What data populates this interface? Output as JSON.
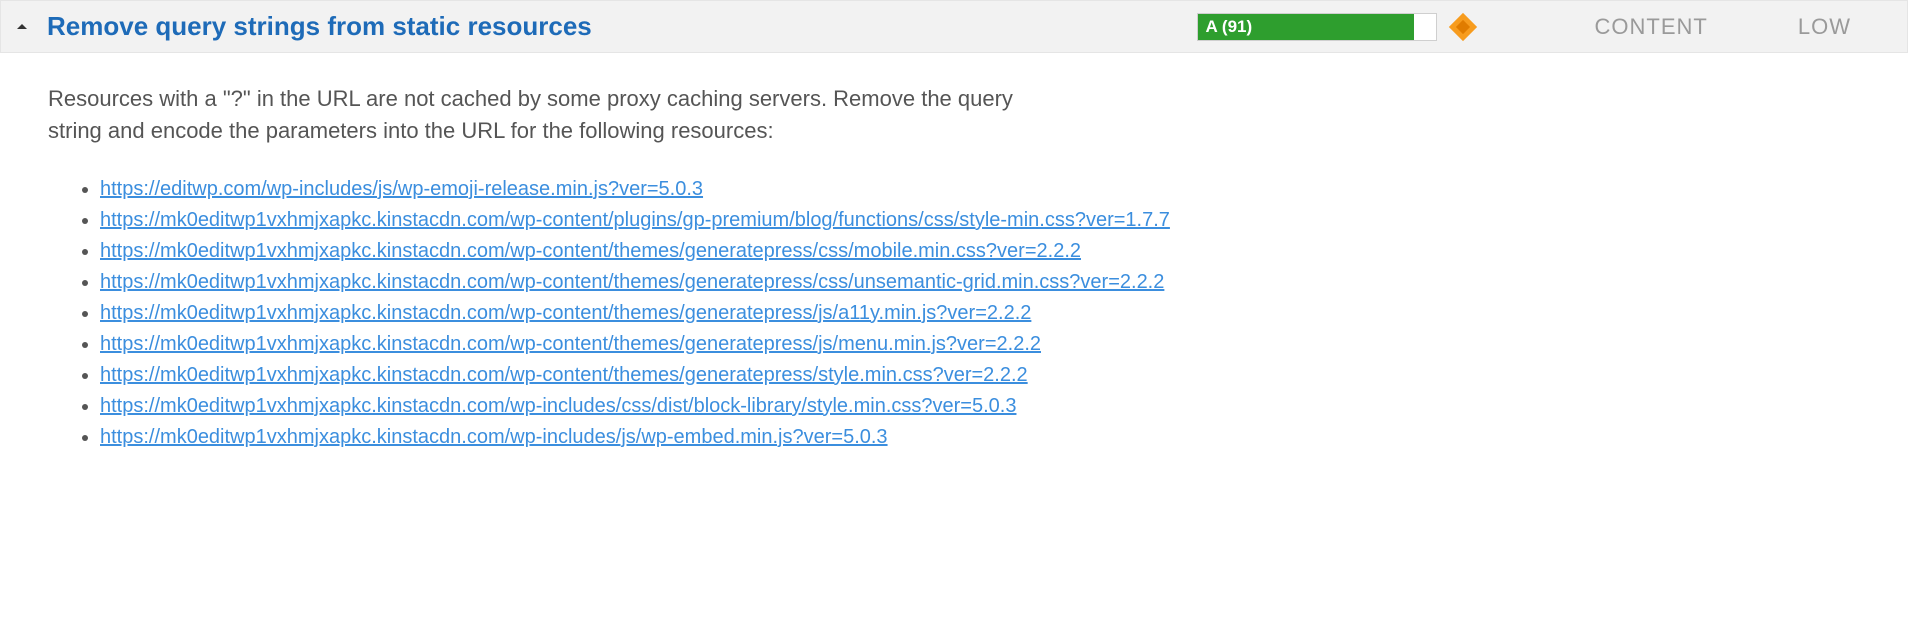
{
  "header": {
    "title": "Remove query strings from static resources",
    "grade_label": "A (91)",
    "grade_percent": 91,
    "category": "CONTENT",
    "priority": "LOW"
  },
  "body": {
    "description": "Resources with a \"?\" in the URL are not cached by some proxy caching servers. Remove the query string and encode the parameters into the URL for the following resources:",
    "resources": [
      "https://editwp.com/wp-includes/js/wp-emoji-release.min.js?ver=5.0.3",
      "https://mk0editwp1vxhmjxapkc.kinstacdn.com/wp-content/plugins/gp-premium/blog/functions/css/style-min.css?ver=1.7.7",
      "https://mk0editwp1vxhmjxapkc.kinstacdn.com/wp-content/themes/generatepress/css/mobile.min.css?ver=2.2.2",
      "https://mk0editwp1vxhmjxapkc.kinstacdn.com/wp-content/themes/generatepress/css/unsemantic-grid.min.css?ver=2.2.2",
      "https://mk0editwp1vxhmjxapkc.kinstacdn.com/wp-content/themes/generatepress/js/a11y.min.js?ver=2.2.2",
      "https://mk0editwp1vxhmjxapkc.kinstacdn.com/wp-content/themes/generatepress/js/menu.min.js?ver=2.2.2",
      "https://mk0editwp1vxhmjxapkc.kinstacdn.com/wp-content/themes/generatepress/style.min.css?ver=2.2.2",
      "https://mk0editwp1vxhmjxapkc.kinstacdn.com/wp-includes/css/dist/block-library/style.min.css?ver=5.0.3",
      "https://mk0editwp1vxhmjxapkc.kinstacdn.com/wp-includes/js/wp-embed.min.js?ver=5.0.3"
    ]
  }
}
